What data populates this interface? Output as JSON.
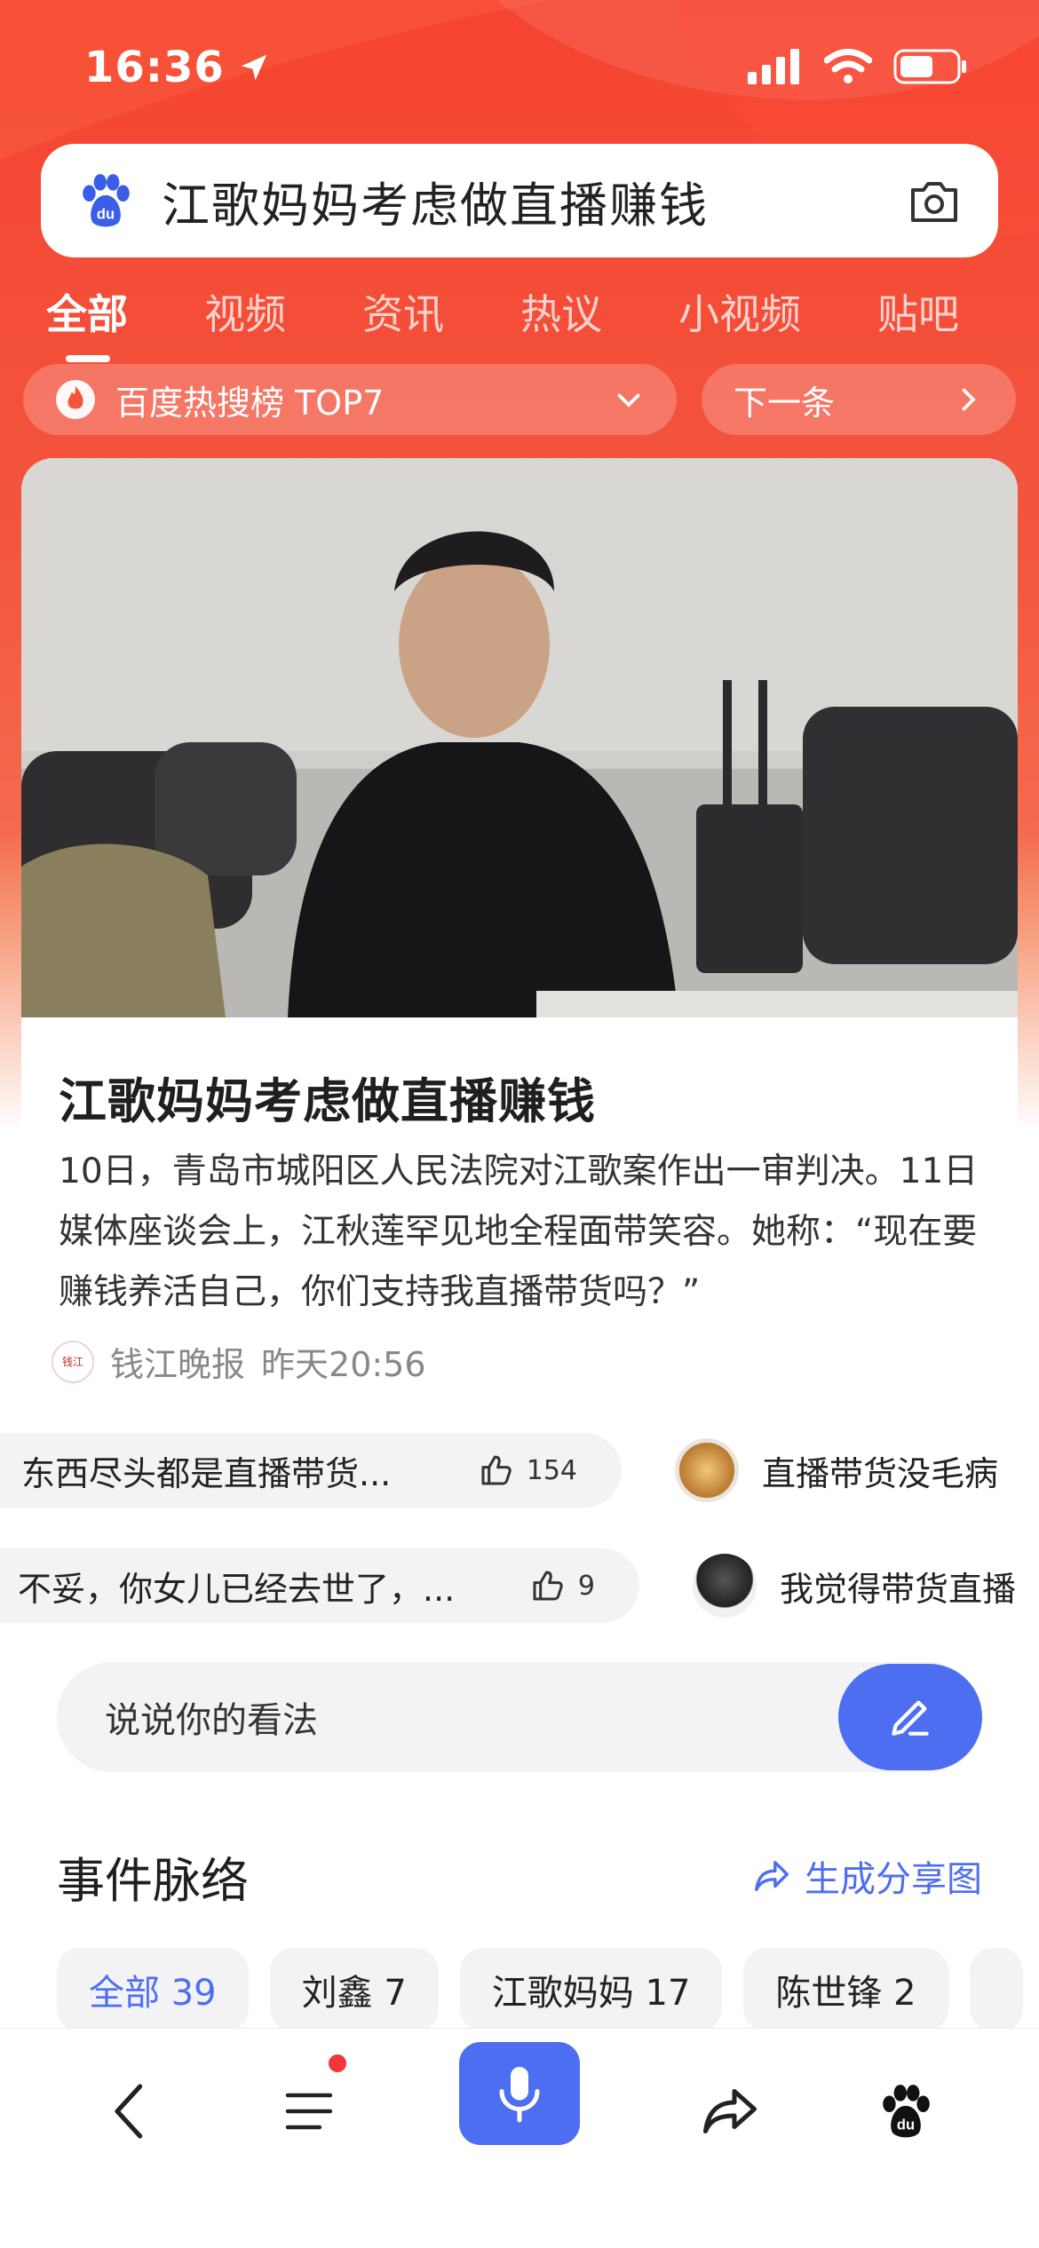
{
  "status_bar": {
    "time": "16:36"
  },
  "search": {
    "query": "江歌妈妈考虑做直播赚钱"
  },
  "tabs": [
    {
      "label": "全部",
      "active": true
    },
    {
      "label": "视频"
    },
    {
      "label": "资讯"
    },
    {
      "label": "热议"
    },
    {
      "label": "小视频"
    },
    {
      "label": "贴吧"
    }
  ],
  "hot_rank": {
    "label": "百度热搜榜 TOP7",
    "next_label": "下一条"
  },
  "article": {
    "title": "江歌妈妈考虑做直播赚钱",
    "body": "10日，青岛市城阳区人民法院对江歌案作出一审判决。11日媒体座谈会上，江秋莲罕见地全程面带笑容。她称：“现在要赚钱养活自己，你们支持我直播带货吗？”",
    "source": "钱江晚报",
    "time": "昨天20:56"
  },
  "comments": [
    {
      "text": "东西尽头都是直播带货...",
      "likes": "154"
    },
    {
      "text": "直播带货没毛病"
    },
    {
      "text": "不妥，你女儿已经去世了，...",
      "likes": "9"
    },
    {
      "text": "我觉得带货直播"
    }
  ],
  "opinion": {
    "placeholder": "说说你的看法"
  },
  "events": {
    "title": "事件脉络",
    "share_label": "生成分享图",
    "chips": [
      {
        "label": "全部 39",
        "active": true
      },
      {
        "label": "刘鑫 7"
      },
      {
        "label": "江歌妈妈 17"
      },
      {
        "label": "陈世锋 2"
      }
    ]
  },
  "colors": {
    "brand_red": "#f5432f",
    "accent_blue": "#4e6ef2"
  }
}
